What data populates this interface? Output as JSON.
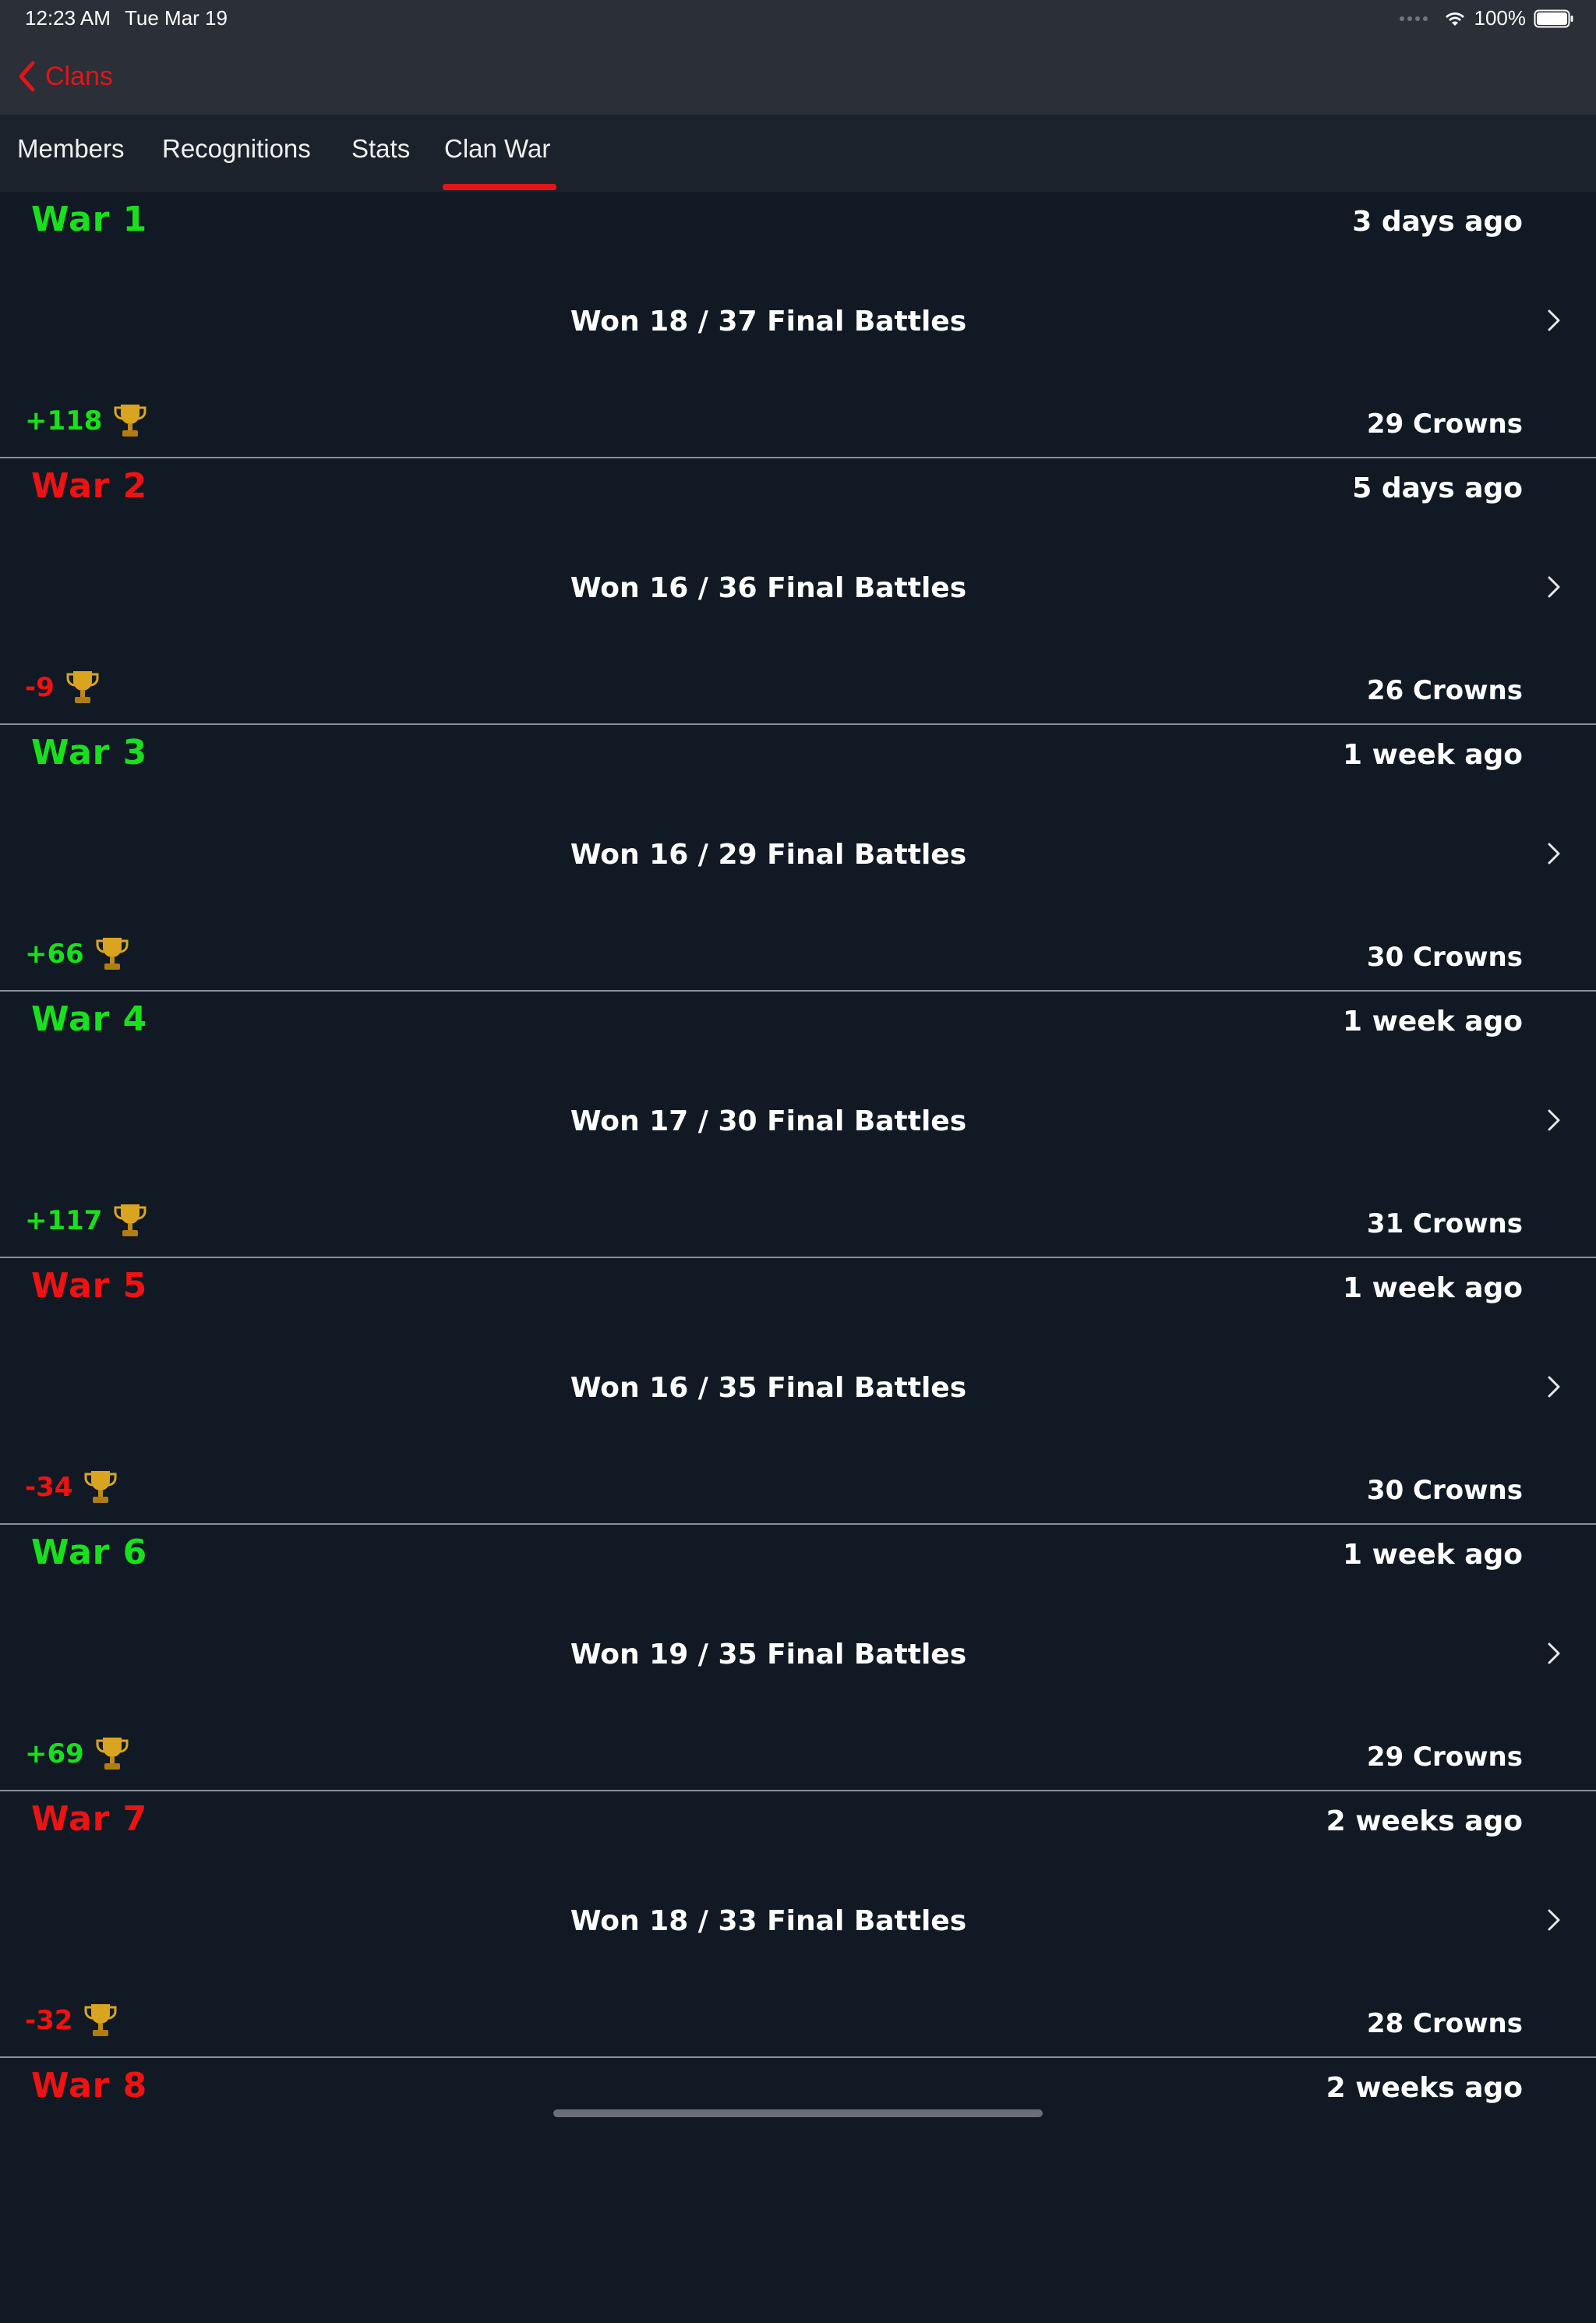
{
  "status_bar": {
    "time": "12:23 AM",
    "date": "Tue Mar 19",
    "battery": "100%"
  },
  "nav": {
    "back_label": "Clans"
  },
  "tabs": [
    {
      "label": "Members"
    },
    {
      "label": "Recognitions"
    },
    {
      "label": "Stats"
    },
    {
      "label": "Clan War"
    }
  ],
  "selected_tab": "Clan War",
  "colors": {
    "accent": "#e0161a",
    "win": "#19e01c",
    "loss": "#ef1212",
    "background": "#111a24"
  },
  "wars": [
    {
      "title": "War 1",
      "result": "win",
      "time": "3 days ago",
      "summary": "Won 18 / 37 Final Battles",
      "trophies": "+118",
      "crowns": "29 Crowns"
    },
    {
      "title": "War 2",
      "result": "loss",
      "time": "5 days ago",
      "summary": "Won 16 / 36 Final Battles",
      "trophies": "-9",
      "crowns": "26 Crowns"
    },
    {
      "title": "War 3",
      "result": "win",
      "time": "1 week ago",
      "summary": "Won 16 / 29 Final Battles",
      "trophies": "+66",
      "crowns": "30 Crowns"
    },
    {
      "title": "War 4",
      "result": "win",
      "time": "1 week ago",
      "summary": "Won 17 / 30 Final Battles",
      "trophies": "+117",
      "crowns": "31 Crowns"
    },
    {
      "title": "War 5",
      "result": "loss",
      "time": "1 week ago",
      "summary": "Won 16 / 35 Final Battles",
      "trophies": "-34",
      "crowns": "30 Crowns"
    },
    {
      "title": "War 6",
      "result": "win",
      "time": "1 week ago",
      "summary": "Won 19 / 35 Final Battles",
      "trophies": "+69",
      "crowns": "29 Crowns"
    },
    {
      "title": "War 7",
      "result": "loss",
      "time": "2 weeks ago",
      "summary": "Won 18 / 33 Final Battles",
      "trophies": "-32",
      "crowns": "28 Crowns"
    },
    {
      "title": "War 8",
      "result": "loss",
      "time": "2 weeks ago"
    }
  ]
}
